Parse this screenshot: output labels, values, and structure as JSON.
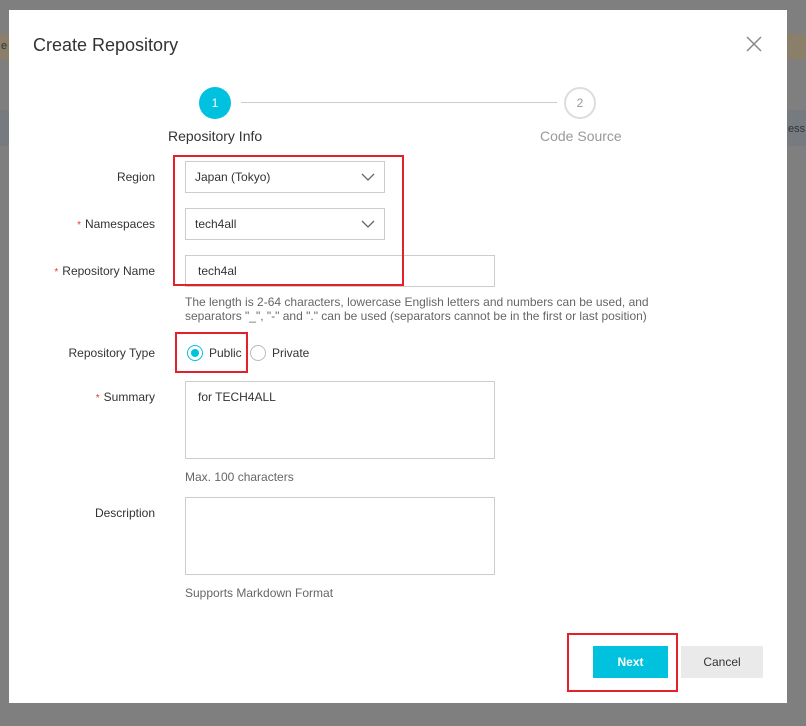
{
  "background": {
    "left_fragment": "e",
    "right_fragment": "ess"
  },
  "modal": {
    "title": "Create Repository"
  },
  "steps": [
    {
      "number": "1",
      "label": "Repository Info"
    },
    {
      "number": "2",
      "label": "Code Source"
    }
  ],
  "form": {
    "region": {
      "label": "Region",
      "value": "Japan (Tokyo)"
    },
    "namespaces": {
      "label": "Namespaces",
      "value": "tech4all",
      "required_mark": "*"
    },
    "repository_name": {
      "label": "Repository Name",
      "value": "tech4al",
      "required_mark": "*",
      "help_line1": "The length is 2-64 characters, lowercase English letters and numbers can be used, and",
      "help_line2": "separators \"_\", \"-\" and \".\" can be used (separators cannot be in the first or last position)"
    },
    "repository_type": {
      "label": "Repository Type",
      "options": [
        "Public",
        "Private"
      ],
      "selected": "Public"
    },
    "summary": {
      "label": "Summary",
      "value": "for TECH4ALL",
      "required_mark": "*",
      "help": "Max. 100 characters"
    },
    "description": {
      "label": "Description",
      "value": "",
      "help": "Supports Markdown Format"
    }
  },
  "buttons": {
    "next": "Next",
    "cancel": "Cancel"
  },
  "colors": {
    "accent": "#00c1de",
    "highlight_box": "#e4202b",
    "required": "#e4393c"
  }
}
